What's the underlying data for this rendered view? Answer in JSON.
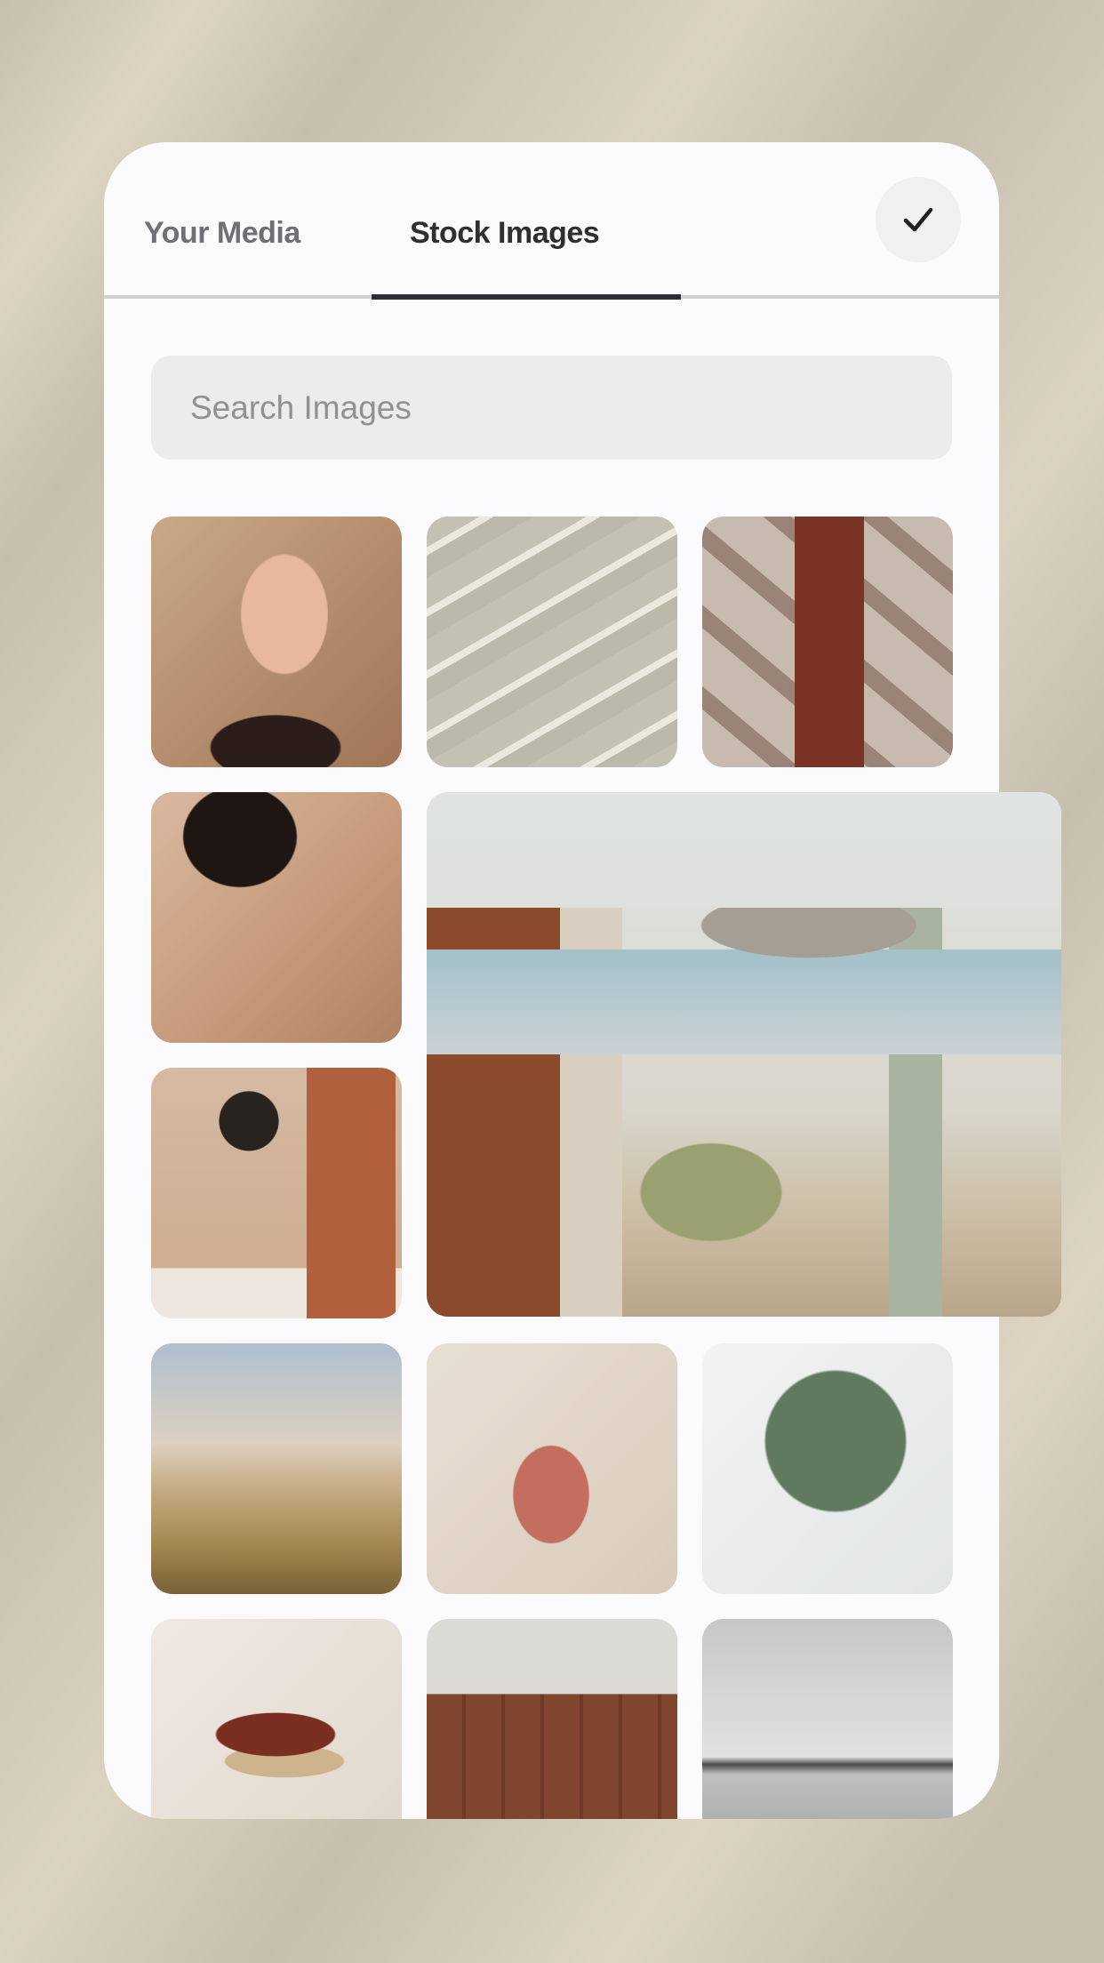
{
  "tabs": [
    {
      "label": "Your Media",
      "active": false
    },
    {
      "label": "Stock Images",
      "active": true
    }
  ],
  "confirm_icon": "checkmark-icon",
  "search": {
    "placeholder": "Search Images",
    "value": ""
  },
  "colors": {
    "active_tab": "#2e2e36",
    "inactive_tab": "#6f6f76",
    "search_bg": "#ececec",
    "card_bg": "#fbfbfd"
  },
  "images": [
    {
      "palette": [
        "#c9a888",
        "#6b4030"
      ]
    },
    {
      "palette": [
        "#c7c4b6",
        "#eeeae0"
      ]
    },
    {
      "palette": [
        "#c7b8ae",
        "#7a3325"
      ]
    },
    {
      "palette": [
        "#d9b8a0",
        "#2a1d18"
      ]
    },
    {
      "palette": [
        "#d5b9a2",
        "#b0603c"
      ]
    },
    {
      "palette": [
        "#b6c0c6",
        "#a48850"
      ]
    },
    {
      "palette": [
        "#e1d8cc",
        "#c36e5e"
      ]
    },
    {
      "palette": [
        "#eef0f0",
        "#5f7a5e"
      ]
    },
    {
      "palette": [
        "#ece4dc",
        "#7a2e22"
      ]
    },
    {
      "palette": [
        "#d8d6d2",
        "#80452e"
      ]
    },
    {
      "palette": [
        "#cfd1d1",
        "#4a4a4a"
      ]
    }
  ]
}
